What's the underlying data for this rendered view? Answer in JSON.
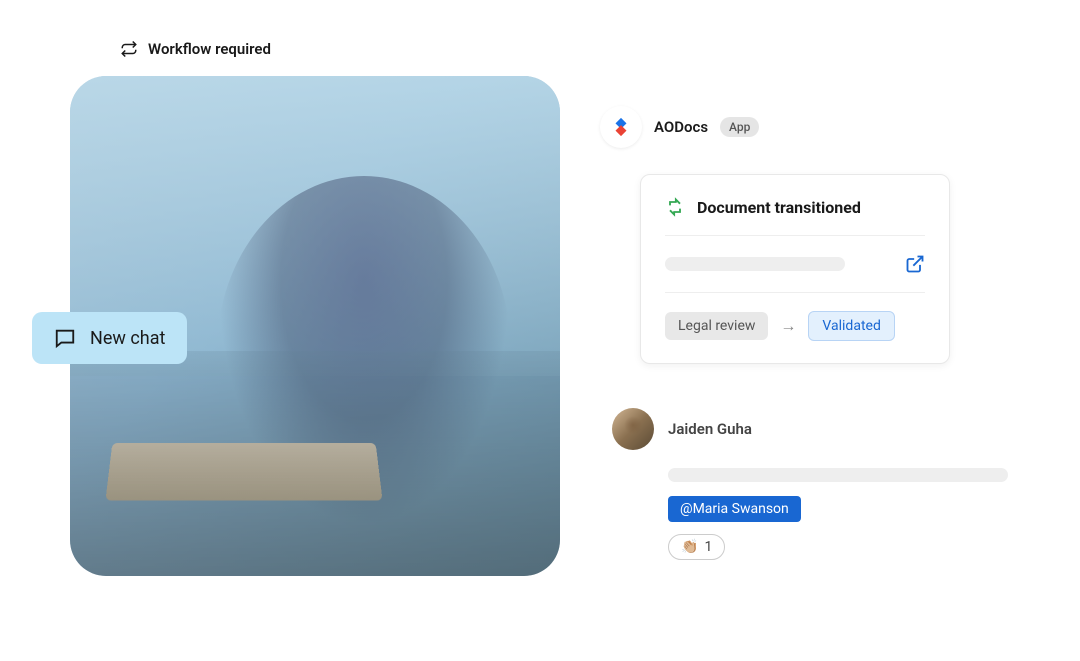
{
  "workflow": {
    "label": "Workflow required"
  },
  "newChat": {
    "label": "New chat"
  },
  "app": {
    "name": "AODocs",
    "badge": "App"
  },
  "transition": {
    "title": "Document transitioned",
    "from": "Legal review",
    "to": "Validated"
  },
  "user": {
    "name": "Jaiden Guha",
    "mention": "@Maria Swanson",
    "reaction": {
      "emoji": "👏🏼",
      "count": "1"
    }
  }
}
